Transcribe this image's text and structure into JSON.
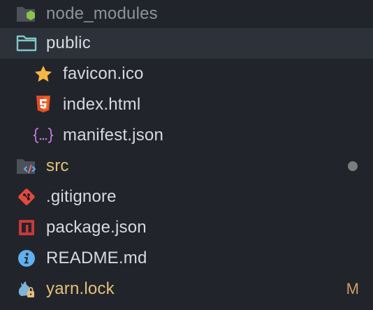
{
  "explorer": {
    "items": [
      {
        "label": "node_modules",
        "icon": "node-modules-folder-icon"
      },
      {
        "label": "public",
        "icon": "folder-open-icon"
      },
      {
        "label": "favicon.ico",
        "icon": "star-icon"
      },
      {
        "label": "index.html",
        "icon": "html5-icon"
      },
      {
        "label": "manifest.json",
        "icon": "json-braces-icon"
      },
      {
        "label": "src",
        "icon": "source-folder-icon"
      },
      {
        "label": ".gitignore",
        "icon": "git-icon"
      },
      {
        "label": "package.json",
        "icon": "npm-icon"
      },
      {
        "label": "README.md",
        "icon": "info-icon"
      },
      {
        "label": "yarn.lock",
        "icon": "yarn-lock-icon",
        "git_status": "M"
      }
    ]
  },
  "colors": {
    "background": "#21252b",
    "selected_row": "#2c313a",
    "text": "#d7dae0",
    "modified_text": "#e5c07b",
    "status_m": "#d19a66"
  }
}
